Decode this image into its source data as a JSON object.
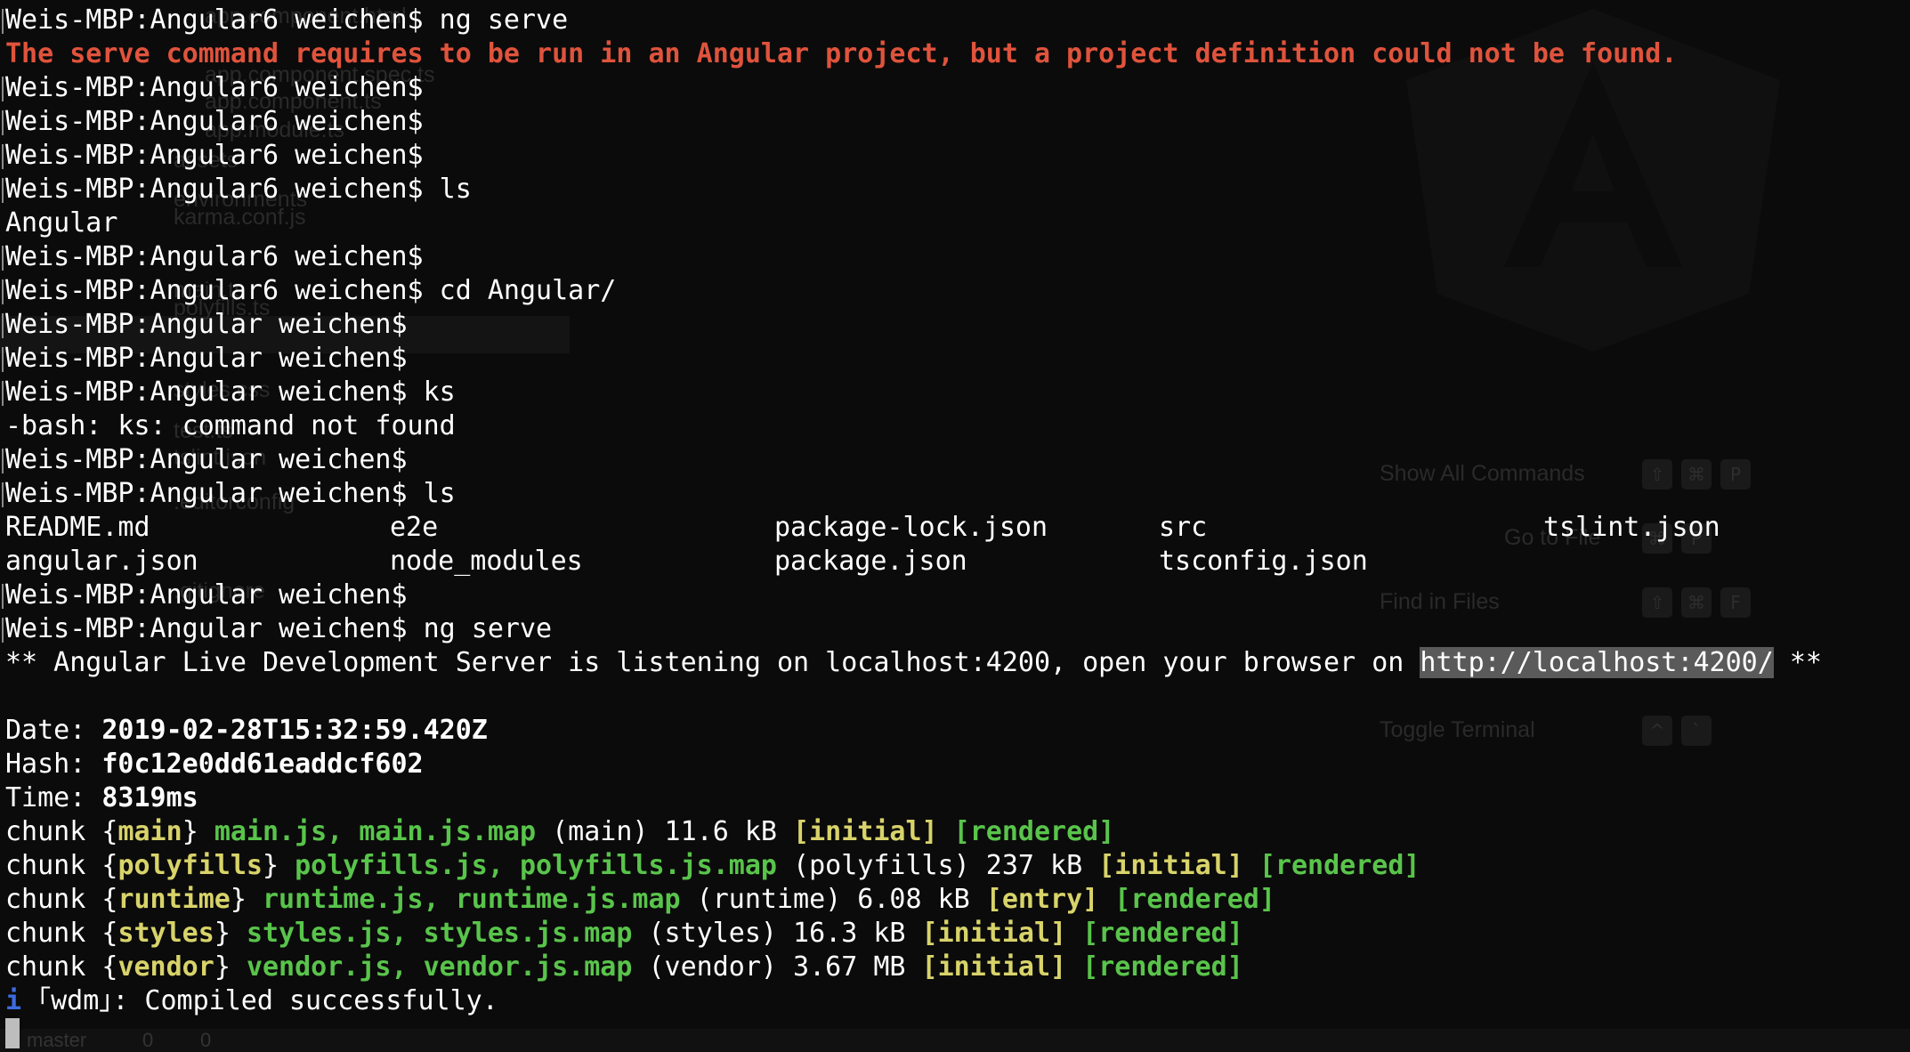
{
  "background_ghost": {
    "files": [
      "app.component.html",
      "app.component.spec.ts",
      "app.component.ts",
      "app.module.ts",
      "assets",
      "environments",
      "karma.conf.js",
      "main.ts",
      "polyfills.ts",
      "styles.css",
      "test.ts",
      "tslint.json",
      ".editorconfig",
      ".gitignore"
    ],
    "commands": [
      {
        "label": "Show All Commands",
        "keys": [
          "⇧",
          "⌘",
          "P"
        ]
      },
      {
        "label": "Go to File",
        "keys": [
          "⌘",
          "P"
        ]
      },
      {
        "label": "Find in Files",
        "keys": [
          "⇧",
          "⌘",
          "F"
        ]
      },
      {
        "label": "Toggle Terminal",
        "keys": [
          "^",
          "`"
        ]
      }
    ],
    "status": {
      "branch": "master",
      "errors": "0",
      "warnings": "0"
    }
  },
  "terminal": {
    "prompt1": "Weis-MBP:Angular6 weichen$",
    "prompt2": "Weis-MBP:Angular weichen$",
    "lines": {
      "l01": "Weis-MBP:Angular6 weichen$ ng serve",
      "l02": "The serve command requires to be run in an Angular project, but a project definition could not be found.",
      "l03": "Weis-MBP:Angular6 weichen$",
      "l04": "Weis-MBP:Angular6 weichen$",
      "l05": "Weis-MBP:Angular6 weichen$",
      "l06": "Weis-MBP:Angular6 weichen$ ls",
      "l07": "Angular",
      "l08": "Weis-MBP:Angular6 weichen$",
      "l09": "Weis-MBP:Angular6 weichen$ cd Angular/",
      "l10": "Weis-MBP:Angular weichen$",
      "l11": "Weis-MBP:Angular weichen$",
      "l12": "Weis-MBP:Angular weichen$ ks",
      "l13": "-bash: ks: command not found",
      "l14": "Weis-MBP:Angular weichen$",
      "l15": "Weis-MBP:Angular weichen$ ls",
      "l18": "Weis-MBP:Angular weichen$",
      "l19": "Weis-MBP:Angular weichen$ ng serve"
    },
    "ls_row1": [
      "README.md",
      "e2e",
      "package-lock.json",
      "src",
      "tslint.json"
    ],
    "ls_row2": [
      "angular.json",
      "node_modules",
      "package.json",
      "tsconfig.json",
      ""
    ],
    "server_pre": "** Angular Live Development Server is listening on localhost:4200, open your browser on ",
    "server_url": "http://localhost:4200/",
    "server_post": " **",
    "date_label": "Date: ",
    "date_value": "2019-02-28T15:32:59.420Z",
    "hash_label": "Hash: ",
    "hash_value": "f0c12e0dd61eaddcf602",
    "time_label": "Time: ",
    "time_value": "8319ms",
    "chunks": [
      {
        "word": "chunk ",
        "name": "main",
        "files": "main.js, main.js.map",
        "paren": "(main)",
        "size": "11.6 kB",
        "tag1": "[initial]",
        "tag2": "[rendered]"
      },
      {
        "word": "chunk ",
        "name": "polyfills",
        "files": "polyfills.js, polyfills.js.map",
        "paren": "(polyfills)",
        "size": "237 kB",
        "tag1": "[initial]",
        "tag2": "[rendered]"
      },
      {
        "word": "chunk ",
        "name": "runtime",
        "files": "runtime.js, runtime.js.map",
        "paren": "(runtime)",
        "size": "6.08 kB",
        "tag1": "[entry]",
        "tag2": "[rendered]"
      },
      {
        "word": "chunk ",
        "name": "styles",
        "files": "styles.js, styles.js.map",
        "paren": "(styles)",
        "size": "16.3 kB",
        "tag1": "[initial]",
        "tag2": "[rendered]"
      },
      {
        "word": "chunk ",
        "name": "vendor",
        "files": "vendor.js, vendor.js.map",
        "paren": "(vendor)",
        "size": "3.67 MB",
        "tag1": "[initial]",
        "tag2": "[rendered]"
      }
    ],
    "wdm_icon": "i",
    "wdm_tag": "｢wdm｣",
    "wdm_msg": ": Compiled successfully."
  },
  "colors": {
    "error": "#e0533c",
    "chunk_name": "#d8d36a",
    "chunk_files": "#59c44b",
    "url_highlight": "#5a5a5a",
    "info_icon": "#3d6be0"
  }
}
